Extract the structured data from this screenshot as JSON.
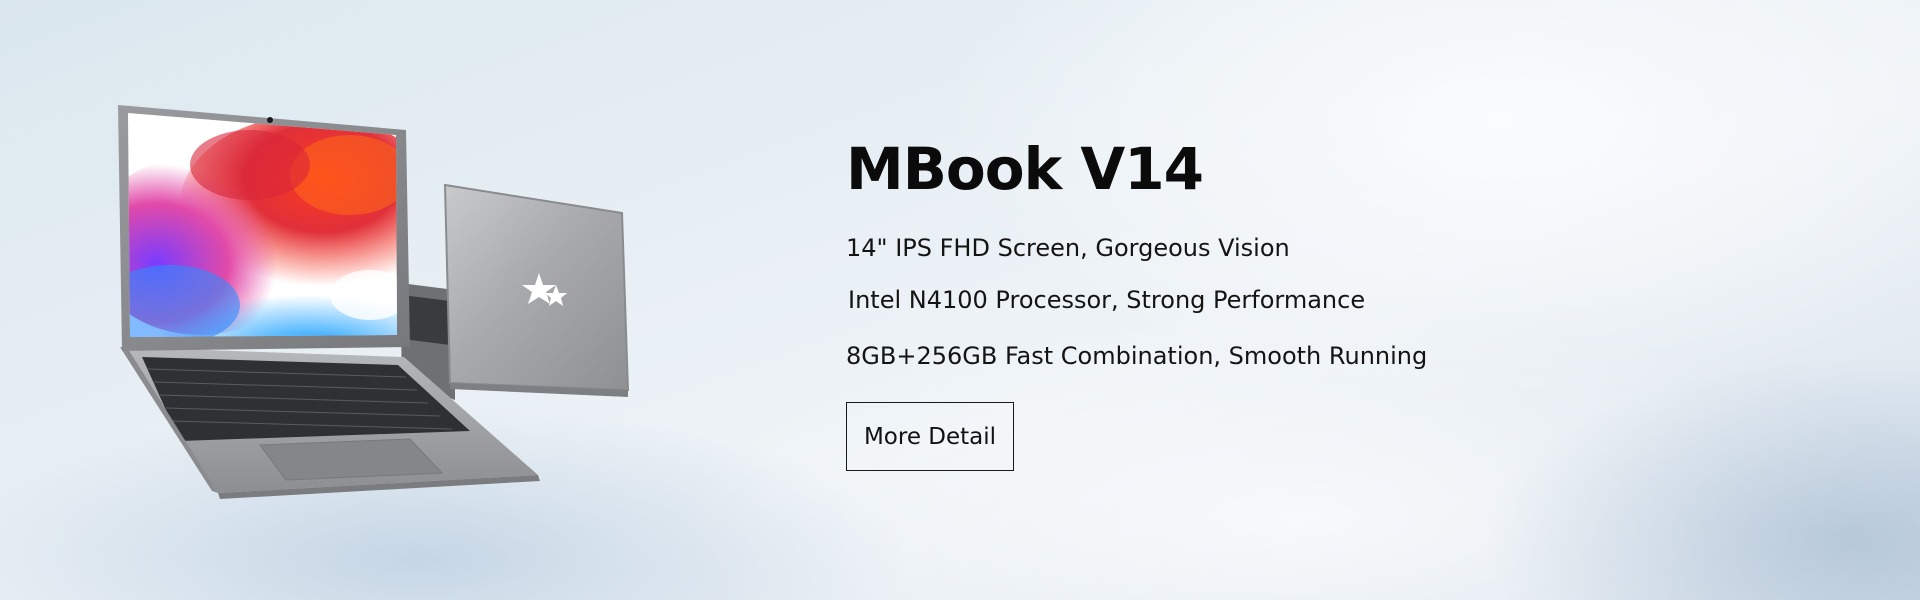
{
  "banner": {
    "title": "MBook V14",
    "features": [
      "14\" IPS FHD Screen, Gorgeous Vision",
      "Intel N4100 Processor, Strong Performance",
      "8GB+256GB Fast Combination, Smooth Running"
    ],
    "cta_label": "More Detail"
  }
}
